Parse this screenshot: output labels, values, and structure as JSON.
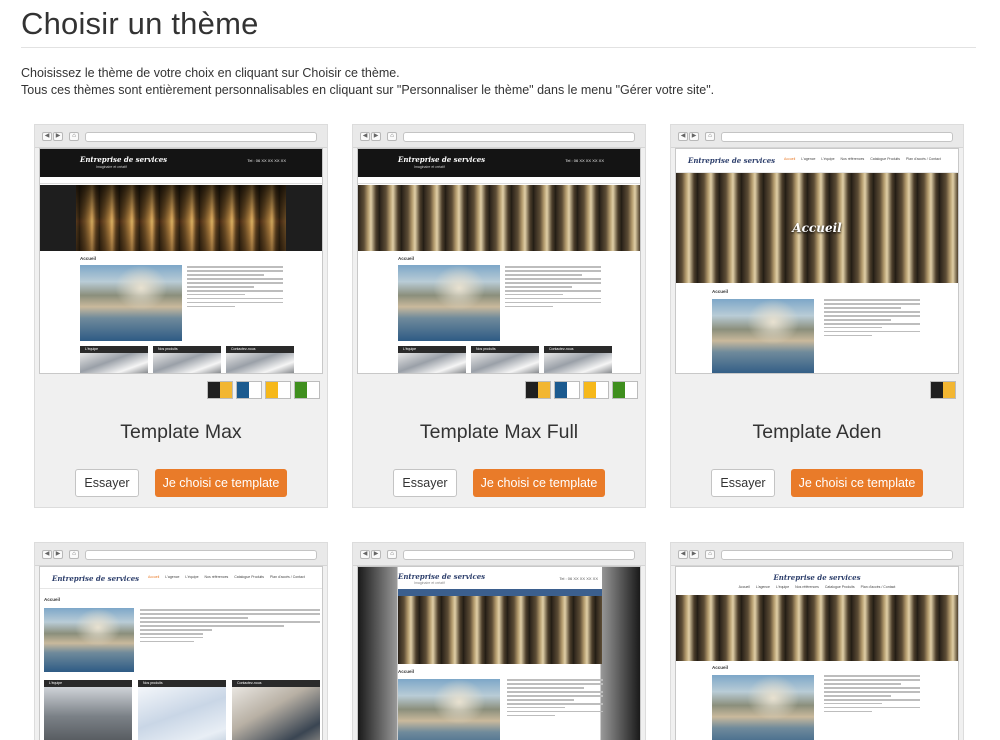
{
  "page": {
    "title": "Choisir un thème",
    "intro_line1": "Choisissez le thème de votre choix en cliquant sur Choisir ce thème.",
    "intro_line2": "Tous ces thèmes sont entièrement personnalisables en cliquant sur \"Personnaliser le thème\" dans le menu \"Gérer votre site\"."
  },
  "buttons": {
    "try_label": "Essayer",
    "choose_label": "Je choisi ce template"
  },
  "mock": {
    "company": "Entreprise de services",
    "tagline": "Imaginaire et créatif",
    "tel": "Tel : 06 XX XX XX XX",
    "nav": [
      "Accueil",
      "L'agence",
      "L'équipe",
      "Nos références",
      "Catalogue Produits",
      "Plan d'accès / Contact"
    ],
    "section_title": "Accueil",
    "boxes": [
      "L'équipe",
      "Nos produits",
      "Contactez-nous"
    ]
  },
  "templates": [
    {
      "name": "Template Max",
      "swatches": [
        [
          "#1f1f1f",
          "#f2b632"
        ],
        [
          "#1b5a8f",
          "#ffffff"
        ],
        [
          "#f6b81a",
          "#ffffff"
        ],
        [
          "#3f8f1e",
          "#ffffff"
        ]
      ]
    },
    {
      "name": "Template Max Full",
      "swatches": [
        [
          "#1f1f1f",
          "#f2b632"
        ],
        [
          "#1b5a8f",
          "#ffffff"
        ],
        [
          "#f6b81a",
          "#ffffff"
        ],
        [
          "#3f8f1e",
          "#ffffff"
        ]
      ]
    },
    {
      "name": "Template Aden",
      "swatches": [
        [
          "#1f1f1f",
          "#f2b632"
        ]
      ]
    },
    {
      "name": ""
    },
    {
      "name": ""
    },
    {
      "name": ""
    }
  ],
  "colors": {
    "accent": "#e97b29",
    "card_bg": "#f0f0f0"
  }
}
